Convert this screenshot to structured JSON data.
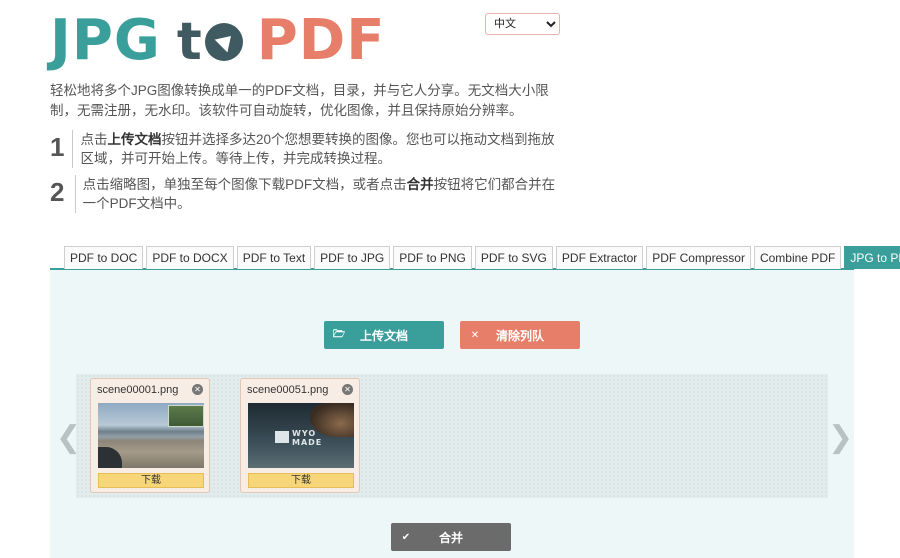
{
  "logo": {
    "part1": "JPG",
    "part2": "t",
    "part3": "PDF"
  },
  "language": {
    "selected": "中文",
    "options": [
      "中文"
    ]
  },
  "intro": "轻松地将多个JPG图像转换成单一的PDF文档，目录，并与它人分享。无文档大小限制，无需注册，无水印。该软件可自动旋转，优化图像，并且保持原始分辨率。",
  "steps": [
    {
      "num": "1",
      "pre": "点击",
      "bold": "上传文档",
      "post": "按钮并选择多达20个您想要转换的图像。您也可以拖动文档到拖放区域，并可开始上传。等待上传，并完成转换过程。"
    },
    {
      "num": "2",
      "pre": "点击缩略图，单独至每个图像下载PDF文档，或者点击",
      "bold": "合并",
      "post": "按钮将它们都合并在一个PDF文档中。"
    }
  ],
  "tabs": [
    "PDF to DOC",
    "PDF to DOCX",
    "PDF to Text",
    "PDF to JPG",
    "PDF to PNG",
    "PDF to SVG",
    "PDF Extractor",
    "PDF Compressor",
    "Combine PDF",
    "JPG to PDF"
  ],
  "active_tab": "JPG to PDF",
  "buttons": {
    "upload": "上传文档",
    "clear": "清除列队",
    "combine": "合并"
  },
  "files": [
    {
      "name": "scene00001.png",
      "download": "下载"
    },
    {
      "name": "scene00051.png",
      "download": "下载",
      "sign_line1": "WYO",
      "sign_line2": "MADE"
    }
  ],
  "nav": {
    "prev": "❮",
    "next": "❯"
  },
  "colors": {
    "teal": "#3a9e9b",
    "coral": "#e77e69",
    "slate": "#3f5a60",
    "gray_button": "#6b6b6b"
  }
}
